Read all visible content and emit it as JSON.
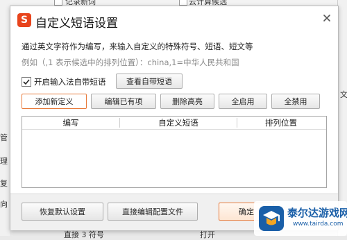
{
  "background": {
    "top_labels": [
      "记录新词",
      "云计算候选"
    ],
    "left_chars": [
      "管",
      "理",
      "复",
      "向"
    ],
    "right_chars": [
      "文"
    ],
    "bottom_labels": [
      "直接 3 符号",
      "打开"
    ]
  },
  "dialog": {
    "logo": "S",
    "title": "自定义短语设置",
    "description": "通过英文字符作为编写，来输入自定义的特殊符号、短语、短文等",
    "example": "例如（,1 表示候选中的排列位置）：china,1=中华人民共和国",
    "builtin": {
      "checkbox_checked": true,
      "label": "开启输入法自带短语",
      "view_button": "查看自带短语"
    },
    "actions": [
      {
        "label": "添加新定义"
      },
      {
        "label": "编辑已有项"
      },
      {
        "label": "删除高亮"
      },
      {
        "label": "全启用"
      },
      {
        "label": "全禁用"
      }
    ],
    "table": {
      "columns": [
        "编写",
        "自定义短语",
        "排列位置"
      ]
    },
    "footer": {
      "restore_button": "恢复默认设置",
      "edit_config_button": "直接编辑配置文件",
      "ok_button": "确定"
    }
  },
  "watermark": {
    "text": "泰尔达游戏网",
    "url": "www.tairda.com"
  },
  "colors": {
    "accent": "#e87a3a",
    "logo": "#e8441c",
    "watermark": "#1a5fa8"
  }
}
